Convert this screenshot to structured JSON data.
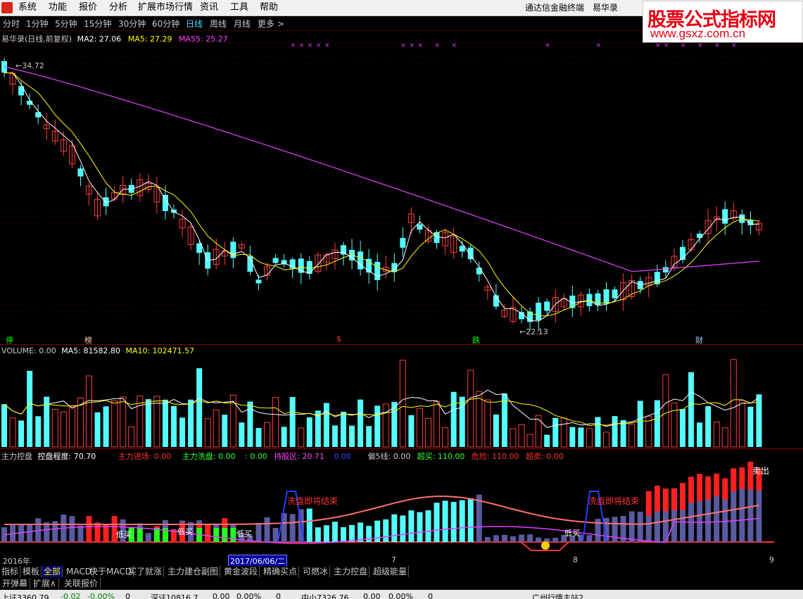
{
  "menu": {
    "items": [
      "系统",
      "功能",
      "报价",
      "分析",
      "扩展市场行情",
      "资讯",
      "工具",
      "帮助"
    ],
    "right_title": "通达信金融终端",
    "stock_name": "易华录"
  },
  "watermark": {
    "line1": "股票公式指标网",
    "line2": "www.gsxz.com.cn"
  },
  "periods": [
    "分时",
    "1分钟",
    "5分钟",
    "15分钟",
    "30分钟",
    "60分钟",
    "日线",
    "周线",
    "月线",
    "更多 >"
  ],
  "active_period": "日线",
  "main_chart": {
    "title": "易华录(日线,前复权)",
    "ma2": "MA2: 27.06",
    "ma5": "MA5: 27.29",
    "ma55": "MA55: 25.27",
    "high_label": "34.72",
    "low_label": "22.13",
    "markers": [
      {
        "text": "停",
        "color": "#00ff00"
      },
      {
        "text": "榜",
        "color": "#ffd0a0"
      },
      {
        "text": "$",
        "color": "#ff3030"
      },
      {
        "text": "跌",
        "color": "#00ff00"
      },
      {
        "text": "财",
        "color": "#a0c8ff"
      }
    ]
  },
  "volume_chart": {
    "title": "VOLUME: 0.00",
    "ma5": "MA5: 81582.80",
    "ma10": "MA10: 102471.57"
  },
  "indicator": {
    "name": "主力控盘",
    "degree": "控盘程度: 70.70",
    "enter": "主力进场: 0.00",
    "wash": "主力洗盘: 0.00",
    "blank": ": 0.00",
    "hold": "持股区: 20.71",
    "hold_val": "0.00",
    "bias": "偏5线: 0.00",
    "overbuy": "超买: 110.00",
    "danger": "危险: 110.00",
    "oversell": "超卖: 0.00",
    "labels": {
      "wash_end": "洗盘即将结束",
      "low_buy": "低买",
      "sell": "卖出"
    }
  },
  "xaxis": {
    "year": "2016年",
    "date_box": "2017/06/06/二",
    "m7": "7",
    "m8": "8",
    "m9": "9"
  },
  "tabs": [
    "指标",
    "模板",
    "全部",
    "MACD",
    "快于MACD",
    "买了就涨",
    "主力建仓副图",
    "黄金波段",
    "精确买点",
    "可燃冰",
    "主力控盘",
    "超级能量"
  ],
  "active_tab": "全部",
  "tabs2": [
    "开弹幕",
    "扩展∧",
    "关联报价"
  ],
  "status": {
    "sh": "上证3360.79",
    "sh_chg": "-0.02",
    "sh_pct": "-0.00%",
    "sh_v": "0",
    "sz": "深证10816.7",
    "sz_chg": "0.00",
    "sz_pct": "0.00%",
    "sz_v": "0",
    "zx": "中小7326.76",
    "zx_chg": "0.00",
    "zx_pct": "0.00%",
    "zx_v": "0",
    "site": "广州行情主站2"
  }
}
